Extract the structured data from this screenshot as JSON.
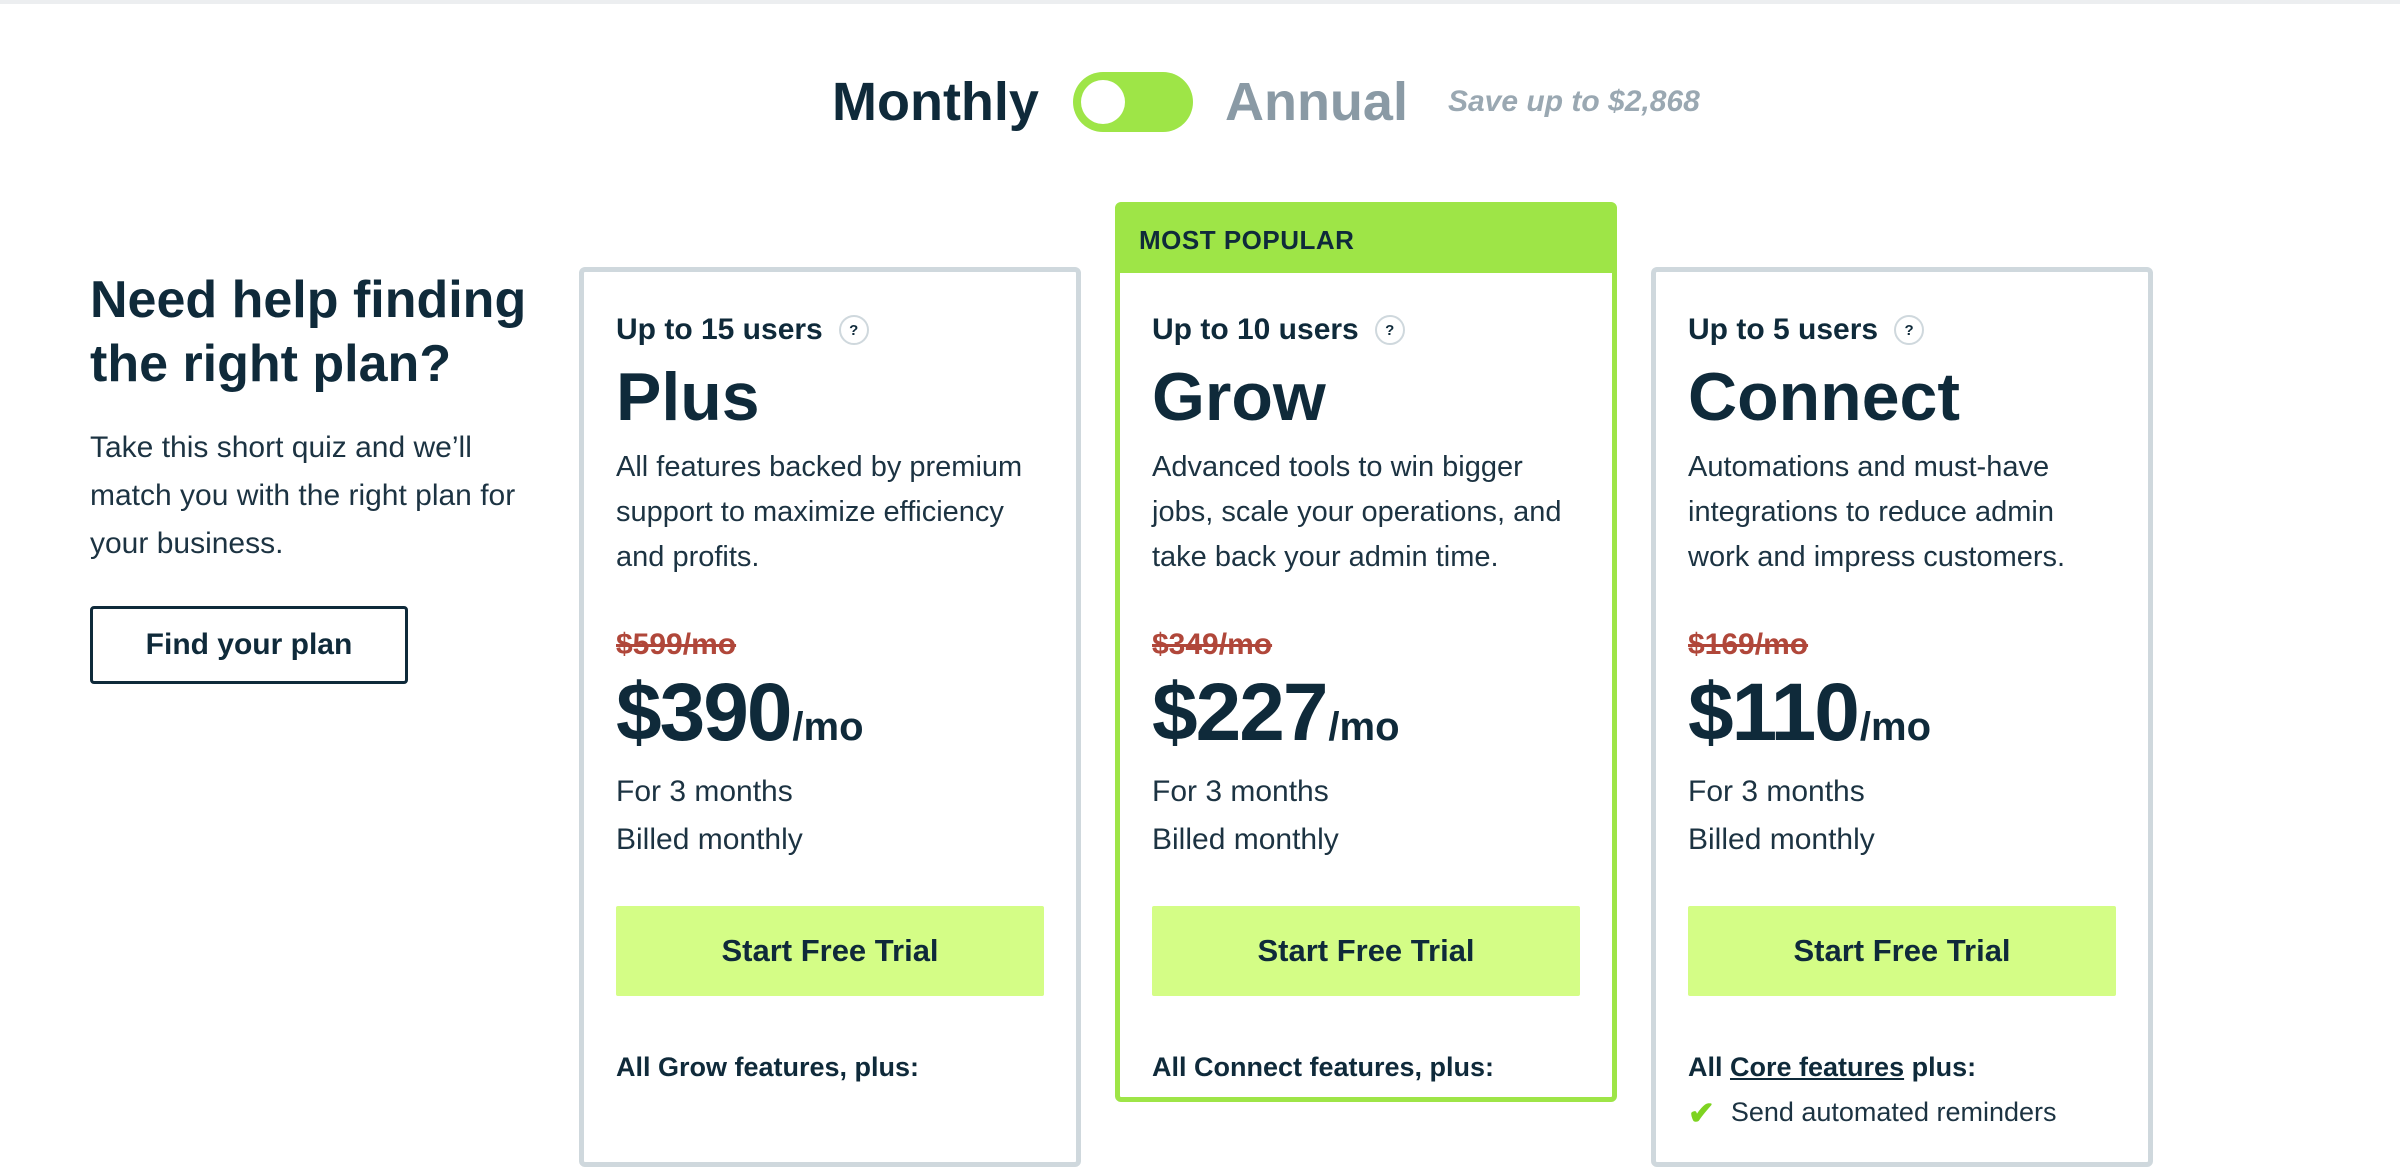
{
  "toggle": {
    "monthly_label": "Monthly",
    "annual_label": "Annual",
    "save_text": "Save up to $2,868",
    "selected": "Monthly",
    "accent": "#9ee547"
  },
  "help": {
    "title": "Need help finding the right plan?",
    "body": "Take this short quiz and we’ll match you with the right plan for your business.",
    "button_label": "Find your plan"
  },
  "plans": [
    {
      "users": "Up to 15 users",
      "help_icon": "?",
      "name": "Plus",
      "description": "All features backed by premium support to maximize efficiency and profits.",
      "old_price": "$599/mo",
      "price": "$390",
      "period": "/mo",
      "term": "For 3 months",
      "billing": "Billed monthly",
      "cta": "Start Free Trial",
      "features_heading": "All Grow features, plus:"
    },
    {
      "badge": "MOST POPULAR",
      "users": "Up to 10 users",
      "help_icon": "?",
      "name": "Grow",
      "description": "Advanced tools to win bigger jobs, scale your operations, and take back your admin time.",
      "old_price": "$349/mo",
      "price": "$227",
      "period": "/mo",
      "term": "For 3 months",
      "billing": "Billed monthly",
      "cta": "Start Free Trial",
      "features_heading": "All Connect features, plus:"
    },
    {
      "users": "Up to 5 users",
      "help_icon": "?",
      "name": "Connect",
      "description": "Automations and must-have integrations to reduce admin work and impress customers.",
      "old_price": "$169/mo",
      "price": "$110",
      "period": "/mo",
      "term": "For 3 months",
      "billing": "Billed monthly",
      "cta": "Start Free Trial",
      "features_prefix": "All ",
      "features_link": "Core features",
      "features_suffix": " plus:",
      "first_feature": "Send automated reminders"
    }
  ],
  "colors": {
    "text_dark": "#0f2a3a",
    "strike_red": "#b0473a",
    "cta_bg": "#d4fd86",
    "card_border": "#cfd8dd"
  }
}
